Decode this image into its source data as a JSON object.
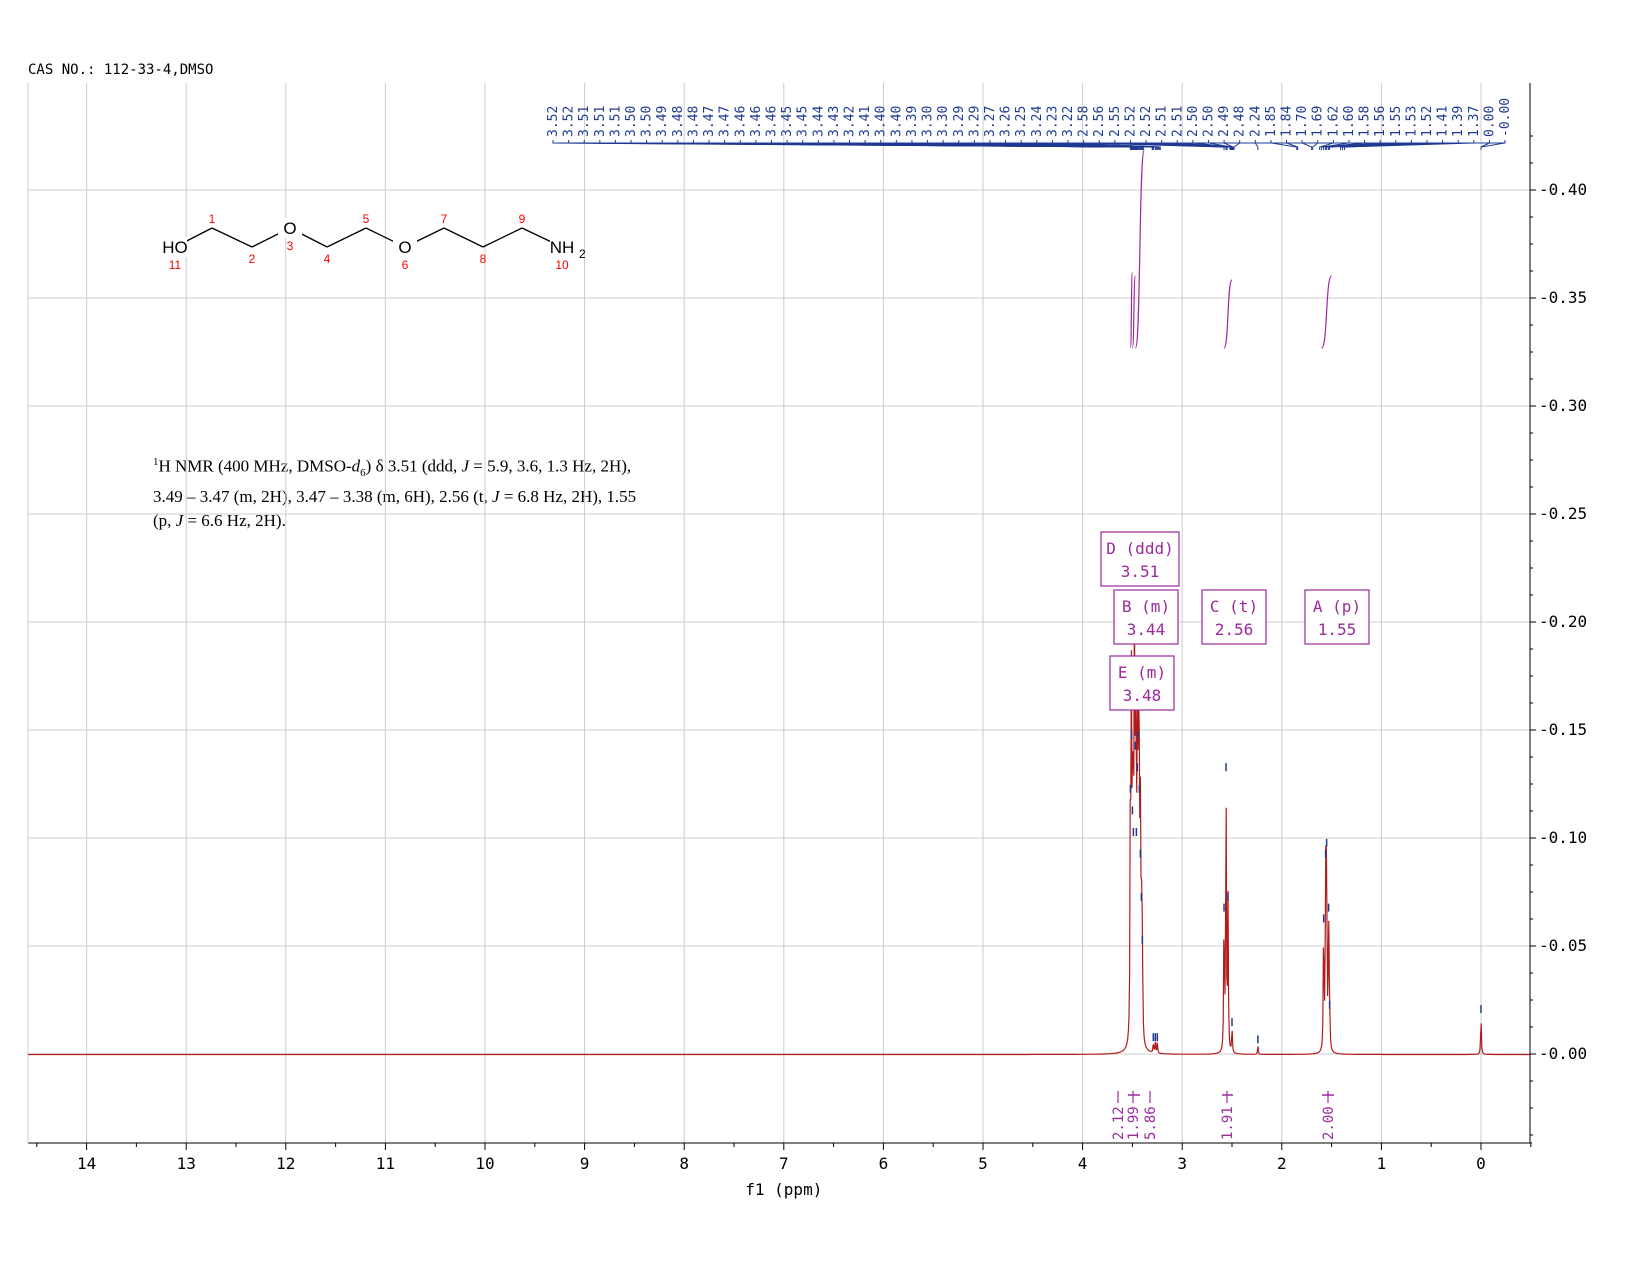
{
  "header": {
    "cas_label": "CAS NO.: 112-33-4,DMSO"
  },
  "nmr_description": {
    "line1": "H NMR (400 MHz, DMSO-",
    "sup": "1",
    "solvent_sub": "6",
    "line1_rest": ") δ 3.51 (ddd, ",
    "j": "J",
    "text_a": " = 5.9, 3.6, 1.3 Hz, 2H),",
    "text_b": "3.49 – 3.47 (m, 2H), 3.47 – 3.38 (m, 6H), 2.56 (t, ",
    "text_c": " = 6.8 Hz, 2H), 1.55",
    "text_d": "(p, ",
    "text_e": " = 6.6 Hz, 2H).",
    "d_letter": "d"
  },
  "structure": {
    "atoms": [
      {
        "label": "HO",
        "num": "11"
      },
      {
        "label": "",
        "num": "1"
      },
      {
        "label": "",
        "num": "2"
      },
      {
        "label": "O",
        "num": "3"
      },
      {
        "label": "",
        "num": "4"
      },
      {
        "label": "",
        "num": "5"
      },
      {
        "label": "O",
        "num": "6"
      },
      {
        "label": "",
        "num": "7"
      },
      {
        "label": "",
        "num": "8"
      },
      {
        "label": "",
        "num": "9"
      },
      {
        "label": "NH",
        "num": "10",
        "sub": "2"
      }
    ]
  },
  "chart_data": {
    "type": "line",
    "xlabel": "f1 (ppm)",
    "xlim": [
      14.5,
      -0.5
    ],
    "ylim": [
      -0.043,
      0.45
    ],
    "x_ticks": [
      "14",
      "13",
      "12",
      "11",
      "10",
      "9",
      "8",
      "7",
      "6",
      "5",
      "4",
      "3",
      "2",
      "1",
      "0"
    ],
    "y_ticks": [
      "0.40",
      "0.35",
      "0.30",
      "0.25",
      "0.20",
      "0.15",
      "0.10",
      "0.05",
      "0.00"
    ],
    "grid": true,
    "peaks": [
      {
        "ppm": 3.52,
        "height": 0.12
      },
      {
        "ppm": 3.51,
        "height": 0.145
      },
      {
        "ppm": 3.5,
        "height": 0.11
      },
      {
        "ppm": 3.49,
        "height": 0.1
      },
      {
        "ppm": 3.48,
        "height": 0.165
      },
      {
        "ppm": 3.47,
        "height": 0.14
      },
      {
        "ppm": 3.46,
        "height": 0.1
      },
      {
        "ppm": 3.45,
        "height": 0.13
      },
      {
        "ppm": 3.44,
        "height": 0.145
      },
      {
        "ppm": 3.43,
        "height": 0.12
      },
      {
        "ppm": 3.42,
        "height": 0.09
      },
      {
        "ppm": 3.41,
        "height": 0.07
      },
      {
        "ppm": 3.4,
        "height": 0.05
      },
      {
        "ppm": 3.29,
        "height": 0.005
      },
      {
        "ppm": 3.27,
        "height": 0.005
      },
      {
        "ppm": 3.25,
        "height": 0.005
      },
      {
        "ppm": 2.58,
        "height": 0.065
      },
      {
        "ppm": 2.56,
        "height": 0.13
      },
      {
        "ppm": 2.54,
        "height": 0.07
      },
      {
        "ppm": 2.5,
        "height": 0.012
      },
      {
        "ppm": 2.24,
        "height": 0.004
      },
      {
        "ppm": 1.58,
        "height": 0.06
      },
      {
        "ppm": 1.56,
        "height": 0.09
      },
      {
        "ppm": 1.55,
        "height": 0.095
      },
      {
        "ppm": 1.53,
        "height": 0.065
      },
      {
        "ppm": 1.52,
        "height": 0.02
      },
      {
        "ppm": 0.0,
        "height": 0.018
      }
    ],
    "peak_labels": [
      "3.52",
      "3.52",
      "3.51",
      "3.51",
      "3.51",
      "3.50",
      "3.50",
      "3.49",
      "3.48",
      "3.48",
      "3.47",
      "3.47",
      "3.46",
      "3.46",
      "3.46",
      "3.45",
      "3.45",
      "3.44",
      "3.43",
      "3.42",
      "3.41",
      "3.40",
      "3.40",
      "3.39",
      "3.30",
      "3.30",
      "3.29",
      "3.29",
      "3.27",
      "3.26",
      "3.25",
      "3.24",
      "3.23",
      "3.22",
      "2.58",
      "2.56",
      "2.55",
      "2.52",
      "2.52",
      "2.51",
      "2.51",
      "2.50",
      "2.50",
      "2.49",
      "2.48",
      "2.24",
      "1.85",
      "1.84",
      "1.70",
      "1.69",
      "1.62",
      "1.60",
      "1.58",
      "1.56",
      "1.55",
      "1.53",
      "1.52",
      "1.41",
      "1.39",
      "1.37",
      "0.00",
      "-0.00"
    ],
    "multiplets": [
      {
        "letter": "D (ddd)",
        "shift": "3.51"
      },
      {
        "letter": "B (m)",
        "shift": "3.44"
      },
      {
        "letter": "C (t)",
        "shift": "2.56"
      },
      {
        "letter": "A (p)",
        "shift": "1.55"
      },
      {
        "letter": "E (m)",
        "shift": "3.48"
      }
    ],
    "integrals": [
      {
        "ppm": 3.51,
        "value": "2.12"
      },
      {
        "ppm": 3.48,
        "value": "1.99"
      },
      {
        "ppm": 3.43,
        "value": "5.86"
      },
      {
        "ppm": 2.56,
        "value": "1.91"
      },
      {
        "ppm": 1.55,
        "value": "2.00"
      }
    ]
  },
  "colors": {
    "spectrum": "#b21b1b",
    "peak_label": "#1f3a93",
    "integral": "#9b2a9b",
    "grid": "#cccccc",
    "atom_num": "#ff0000"
  }
}
